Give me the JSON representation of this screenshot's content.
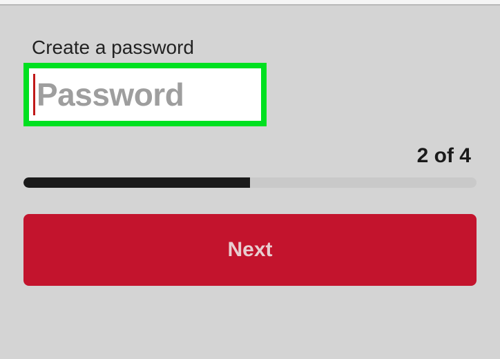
{
  "form": {
    "label": "Create a password",
    "placeholder": "Password",
    "value": ""
  },
  "progress": {
    "step_text": "2 of 4",
    "current": 2,
    "total": 4,
    "percent": 50
  },
  "actions": {
    "next_label": "Next"
  },
  "colors": {
    "highlight": "#00e020",
    "primary": "#c3142d",
    "cursor": "#c01818"
  }
}
